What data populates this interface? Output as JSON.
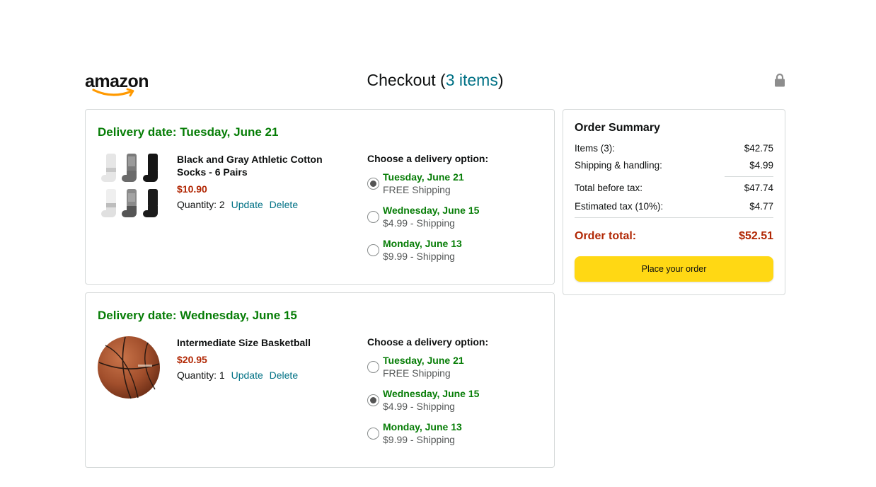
{
  "header": {
    "logo_text": "amazon",
    "title_prefix": "Checkout (",
    "title_items": "3 items",
    "title_suffix": ")"
  },
  "shipments": [
    {
      "delivery_title": "Delivery date: Tuesday, June 21",
      "product_name": "Black and Gray Athletic Cotton Socks - 6 Pairs",
      "price": "$10.90",
      "quantity": "Quantity: 2",
      "update_label": "Update",
      "delete_label": "Delete",
      "options_heading": "Choose a delivery option:",
      "options": [
        {
          "date": "Tuesday, June 21",
          "cost": "FREE Shipping",
          "selected": true
        },
        {
          "date": "Wednesday, June 15",
          "cost": "$4.99 - Shipping",
          "selected": false
        },
        {
          "date": "Monday, June 13",
          "cost": "$9.99 - Shipping",
          "selected": false
        }
      ]
    },
    {
      "delivery_title": "Delivery date: Wednesday, June 15",
      "product_name": "Intermediate Size Basketball",
      "price": "$20.95",
      "quantity": "Quantity: 1",
      "update_label": "Update",
      "delete_label": "Delete",
      "options_heading": "Choose a delivery option:",
      "options": [
        {
          "date": "Tuesday, June 21",
          "cost": "FREE Shipping",
          "selected": false
        },
        {
          "date": "Wednesday, June 15",
          "cost": "$4.99 - Shipping",
          "selected": true
        },
        {
          "date": "Monday, June 13",
          "cost": "$9.99 - Shipping",
          "selected": false
        }
      ]
    }
  ],
  "summary": {
    "title": "Order Summary",
    "items_label": "Items (3):",
    "items_value": "$42.75",
    "shipping_label": "Shipping & handling:",
    "shipping_value": "$4.99",
    "before_tax_label": "Total before tax:",
    "before_tax_value": "$47.74",
    "tax_label": "Estimated tax (10%):",
    "tax_value": "$4.77",
    "total_label": "Order total:",
    "total_value": "$52.51",
    "place_order_label": "Place your order"
  },
  "colors": {
    "link": "#007185",
    "delivery_green": "#067d06",
    "price_red": "#b12704",
    "button_yellow": "#ffd814",
    "logo_smile": "#ff9900"
  },
  "icons": [
    "amazon-smile-logo",
    "lock-icon",
    "radio-icon"
  ]
}
